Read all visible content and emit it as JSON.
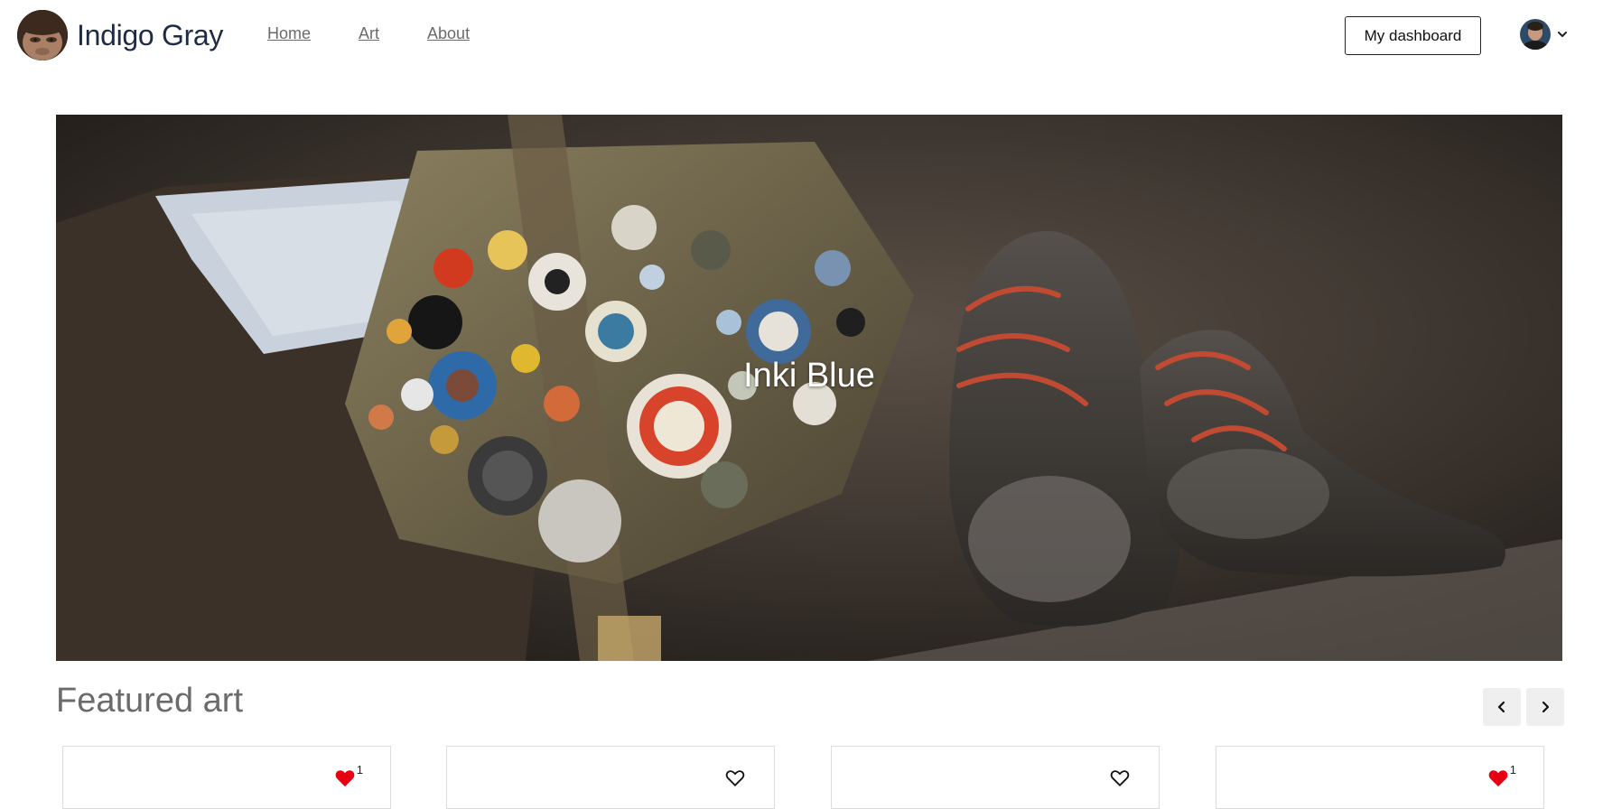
{
  "brand": {
    "name": "Indigo Gray"
  },
  "nav": {
    "items": [
      {
        "label": "Home"
      },
      {
        "label": "Art"
      },
      {
        "label": "About"
      }
    ]
  },
  "header": {
    "dashboard_label": "My dashboard"
  },
  "hero": {
    "title": "Inki Blue"
  },
  "featured": {
    "title": "Featured art",
    "cards": [
      {
        "liked": true,
        "likes": "1"
      },
      {
        "liked": false,
        "likes": ""
      },
      {
        "liked": false,
        "likes": ""
      },
      {
        "liked": true,
        "likes": "1"
      }
    ]
  },
  "colors": {
    "brand_text": "#1f2a44",
    "like_red": "#e60012",
    "muted_text": "#6b6b6b"
  },
  "icons": {
    "prev": "chevron-left-icon",
    "next": "chevron-right-icon",
    "like_filled": "heart-filled-icon",
    "like_empty": "heart-outline-icon",
    "menu": "chevron-down-icon"
  }
}
